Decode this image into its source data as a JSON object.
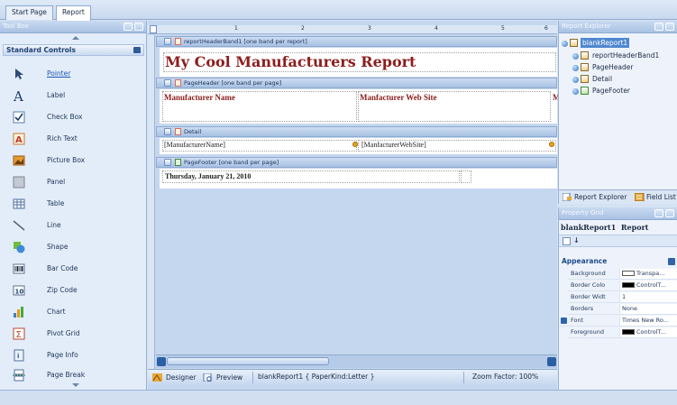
{
  "tabs": [
    {
      "label": "Start Page",
      "active": false
    },
    {
      "label": "Report",
      "active": true
    }
  ],
  "toolbox": {
    "title": "Tool Box",
    "group": "Standard Controls",
    "items": [
      {
        "label": "Pointer",
        "icon": "pointer-arrow-icon",
        "selected": true
      },
      {
        "label": "Label",
        "icon": "label-a-icon"
      },
      {
        "label": "Check Box",
        "icon": "checkbox-icon"
      },
      {
        "label": "Rich Text",
        "icon": "rich-text-icon"
      },
      {
        "label": "Picture Box",
        "icon": "picture-icon"
      },
      {
        "label": "Panel",
        "icon": "panel-icon"
      },
      {
        "label": "Table",
        "icon": "table-icon"
      },
      {
        "label": "Line",
        "icon": "line-icon"
      },
      {
        "label": "Shape",
        "icon": "shape-icon"
      },
      {
        "label": "Bar Code",
        "icon": "barcode-icon"
      },
      {
        "label": "Zip Code",
        "icon": "zipcode-icon"
      },
      {
        "label": "Chart",
        "icon": "chart-icon"
      },
      {
        "label": "Pivot Grid",
        "icon": "pivot-grid-icon"
      },
      {
        "label": "Page Info",
        "icon": "page-info-icon"
      },
      {
        "label": "Page Break",
        "icon": "page-break-icon"
      }
    ]
  },
  "designer": {
    "ruler_marks": [
      "1",
      "2",
      "3",
      "4",
      "5",
      "6"
    ],
    "bands": {
      "report_header": "reportHeaderBand1 [one band per report]",
      "page_header": "PageHeader [one band per page]",
      "detail": "Detail",
      "page_footer": "PageFooter [one band per page]"
    },
    "report_title": "My Cool Manufacturers Report",
    "headers": {
      "col1": "Manufacturer Name",
      "col2": "Manfacturer Web Site",
      "col3": "M"
    },
    "detail_fields": {
      "col1": "[ManufacturerName]",
      "col2": "[ManfacturerWebSite]"
    },
    "footer_date": "Thursday, January 21, 2010"
  },
  "status": {
    "designer_tab": "Designer",
    "preview_tab": "Preview",
    "document": "blankReport1 { PaperKind:Letter }",
    "zoom": "Zoom Factor: 100%"
  },
  "explorer": {
    "title": "Report Explorer",
    "root": "blankReport1",
    "children": [
      "reportHeaderBand1",
      "PageHeader",
      "Detail",
      "PageFooter"
    ],
    "tabs": {
      "explorer": "Report Explorer",
      "fieldlist": "Field List"
    }
  },
  "property_grid": {
    "title": "Property Grid",
    "object_name": "blankReport1",
    "object_type": "Report",
    "category": "Appearance",
    "properties": [
      {
        "name": "Background",
        "value": "Transpa...",
        "swatch": "#ffffff"
      },
      {
        "name": "Border Colo",
        "value": "ControlT...",
        "swatch": "#000000"
      },
      {
        "name": "Border Widt",
        "value": "1"
      },
      {
        "name": "Borders",
        "value": "None"
      },
      {
        "name": "Font",
        "value": "Times New Ro..."
      },
      {
        "name": "Foreground",
        "value": "ControlT...",
        "swatch": "#000000"
      }
    ]
  },
  "colors": {
    "accent": "#4f87cf",
    "report_text": "#8c1d1d",
    "panel_bg": "#e3edf9"
  }
}
